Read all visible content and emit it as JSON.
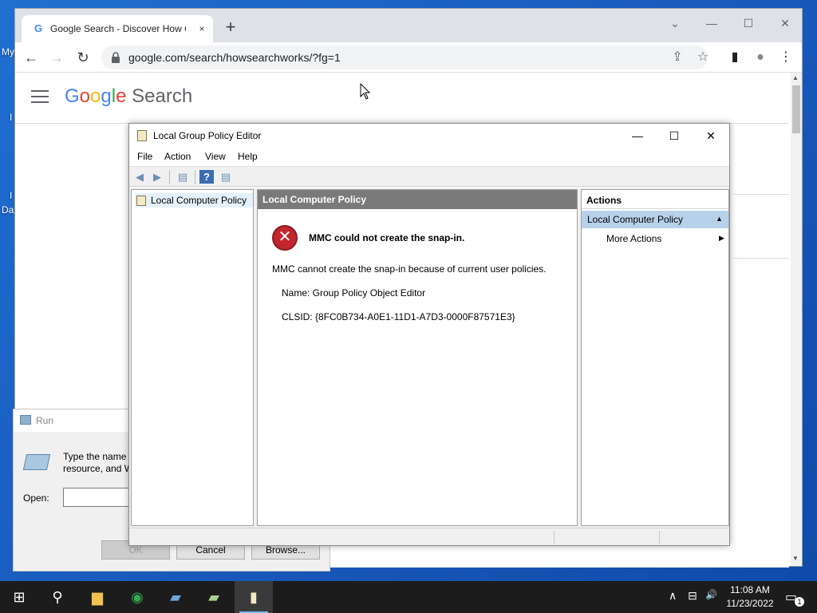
{
  "desktop": {
    "labels": [
      "My",
      "I",
      "I",
      "Da"
    ]
  },
  "chrome": {
    "tab": {
      "favicon": "G",
      "title": "Google Search - Discover How G",
      "close_glyph": "×"
    },
    "new_tab_glyph": "+",
    "window_buttons": {
      "search_tabs": "⌄",
      "minimize": "—",
      "maximize": "☐",
      "close": "✕"
    },
    "toolbar": {
      "back": "←",
      "forward": "→",
      "reload": "↻"
    },
    "url": "google.com/search/howsearchworks/?fg=1",
    "icons": {
      "share": "⇪",
      "star": "☆",
      "sidepanel": "▮",
      "profile": "●",
      "menu": "⋮"
    },
    "page": {
      "logo_letters": [
        {
          "ch": "G",
          "color": "#4285f4"
        },
        {
          "ch": "o",
          "color": "#ea4335"
        },
        {
          "ch": "o",
          "color": "#fbbc05"
        },
        {
          "ch": "g",
          "color": "#4285f4"
        },
        {
          "ch": "l",
          "color": "#34a853"
        },
        {
          "ch": "e",
          "color": "#ea4335"
        }
      ],
      "logo_suffix": "Search"
    }
  },
  "run_dialog": {
    "title": "Run",
    "description": "Type the name of a program, folder, document, or Internet resource, and W",
    "desc_line1": "Type the name o",
    "desc_line2": "resource, and W",
    "open_label": "Open:",
    "open_value": "",
    "ok_label": "OK",
    "cancel_label": "Cancel",
    "browse_label": "Browse..."
  },
  "mmc": {
    "title": "Local Group Policy Editor",
    "window_buttons": {
      "minimize": "—",
      "maximize": "☐",
      "close": "✕"
    },
    "menus": [
      "File",
      "Action",
      "View",
      "Help"
    ],
    "toolbar": {
      "back": "◀",
      "forward": "▶",
      "show_hide": "▤",
      "help": "?",
      "action_pane": "▤"
    },
    "tree": {
      "root": "Local Computer Policy"
    },
    "center": {
      "header": "Local Computer Policy",
      "error_glyph": "✕",
      "error_title": "MMC could not create the snap-in.",
      "error_message": "MMC cannot create the snap-in because of current user policies.",
      "name_line": "Name: Group Policy Object Editor",
      "clsid_line": "CLSID: {8FC0B734-A0E1-11D1-A7D3-0000F87571E3}"
    },
    "actions": {
      "header": "Actions",
      "section": "Local Computer Policy",
      "section_arrow": "▲",
      "more": "More Actions",
      "more_arrow": "▶"
    }
  },
  "taskbar": {
    "start": "⊞",
    "search": "⚲",
    "apps": [
      {
        "name": "file-explorer",
        "glyph": "▆",
        "color": "#f2c14e"
      },
      {
        "name": "chrome",
        "glyph": "◉",
        "color": "#34a853"
      },
      {
        "name": "server-manager",
        "glyph": "▰",
        "color": "#6fa8dc"
      },
      {
        "name": "notes",
        "glyph": "▰",
        "color": "#a9d08e"
      },
      {
        "name": "policy-editor",
        "glyph": "▮",
        "color": "#f4e9c6"
      }
    ],
    "tray": {
      "chevron": "∧",
      "network": "⊟",
      "volume": "🔊",
      "notifications": "▭",
      "notification_count": "1"
    },
    "time": "11:08 AM",
    "date": "11/23/2022"
  }
}
